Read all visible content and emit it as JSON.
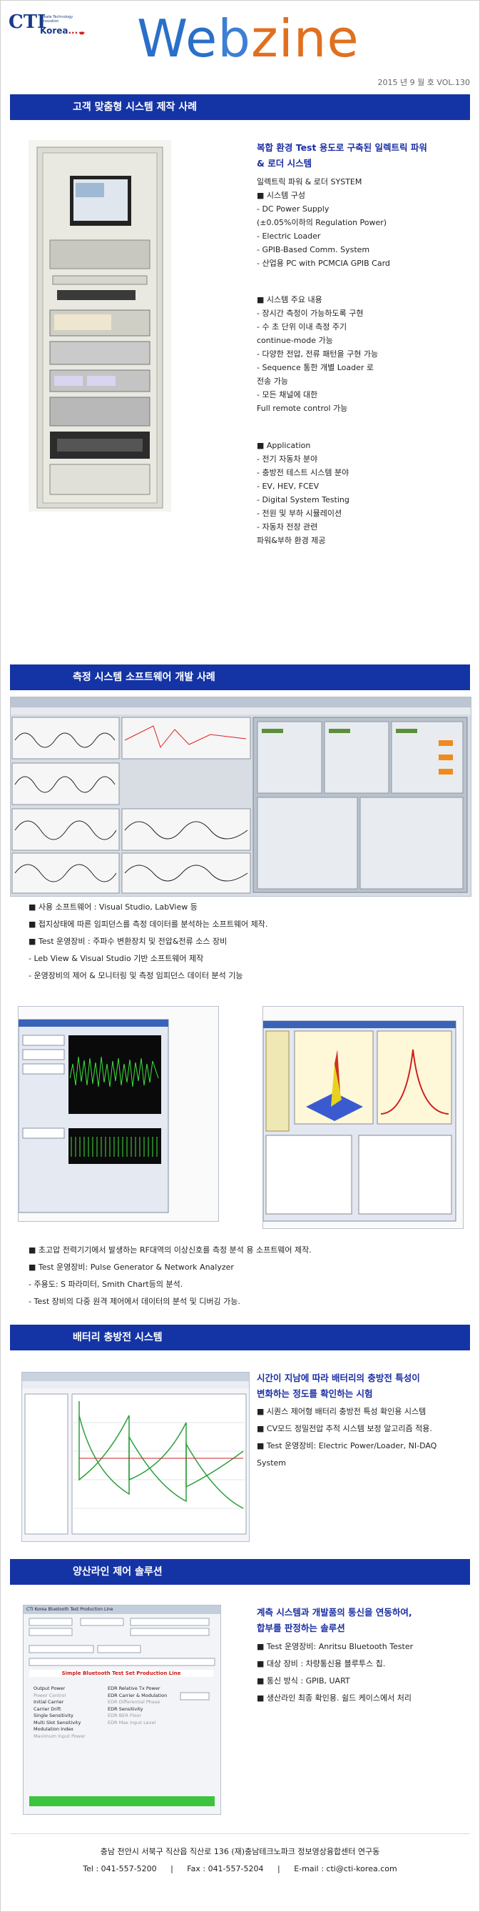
{
  "header": {
    "logo_main": "CTI",
    "logo_tag_1": "Create Technology Innovation",
    "logo_korea": "Korea",
    "logo_suffix": "...ᇂ",
    "title_letters": [
      "We",
      "b",
      "zine"
    ],
    "issue": "2015 년 9 월 호 VOL.130"
  },
  "section1": {
    "bar_title": "고객 맞춤형 시스템 제작 사례",
    "heading_1": "복합 환경 Test 용도로 구축된 일렉트릭 파워",
    "heading_2": "& 로더 시스템",
    "lines": [
      "일렉트릭 파워 & 로더 SYSTEM",
      "■ 시스템 구성",
      "- DC Power Supply",
      "(±0.05%이하의 Regulation Power)",
      "- Electric Loader",
      "- GPIB-Based Comm. System",
      "- 산업용 PC with PCMCIA GPIB Card",
      "",
      "■ 시스템 주요 내용",
      "- 장시간 측정이 가능하도록 구현",
      "- 수 초 단위 이내 측정 주기",
      "continue-mode 가능",
      "- 다양한 전압, 전류 패턴을 구현 가능",
      "- Sequence 통한 개별 Loader 로",
      "전송 가능",
      "- 모든 채널에 대한",
      "Full remote control 가능",
      "",
      "",
      "■ Application",
      "- 전기 자동차 분야",
      "- 충방전 테스트 시스템 분야",
      "- EV, HEV, FCEV",
      "- Digital System Testing",
      "- 전원 및 부하 시뮬레이션",
      "- 자동차 전장 관련",
      "파워&부하 환경 제공"
    ]
  },
  "section2": {
    "bar_title": "측정 시스템 소프트웨어 개발 사례",
    "bullets_a": [
      "■ 사용 소프트웨어 : Visual Studio, LabView 등",
      "■ 접지상태에 따른 임피던스를 측정 데이터를 분석하는 소프트웨어 제작.",
      "■ Test 운영장비 : 주파수 변환장치 및 전압&전류 소스 장비",
      "- Leb View & Visual Studio 기반 소프트웨어 제작",
      "- 운영장비의 제어 & 모니터링 및 측정 임피던스 데이터 분석 기능"
    ],
    "bullets_b": [
      "■ 초고압 전력기기에서 발생하는 RF대역의 이상신호를 측정 분석 용 소프트웨어 제작.",
      "■ Test 운영장비: Pulse Generator & Network Analyzer",
      "- 주용도: S 파라미터, Smith Chart등의 분석.",
      "- Test 장비의 다중 원격 제어에서 데이터의 분석 및 디버깅 가능."
    ]
  },
  "section3": {
    "bar_title": "배터리 충방전 시스템",
    "heading_1": "시간이 지남에 따라 배터리의 충방전 특성이",
    "heading_2": "변화하는 정도를 확인하는 시험",
    "bullets": [
      "■ 시퀀스 제어형 배터리 충방전 특성 확인용 시스템",
      "■ CV모드 정밀전압 추적 시스템 보정 알고리즘 적용.",
      "■ Test 운영장비: Electric Power/Loader, NI-DAQ",
      "System"
    ]
  },
  "section4": {
    "bar_title": "양산라인 제어 솔루션",
    "heading_1": "계측 시스템과 개발품의 통신을 연동하여,",
    "heading_2": "합부를 판정하는 솔루션",
    "bullets": [
      "■ Test 운영장비: Anritsu Bluetooth Tester",
      "■ 대상 장비 : 차량통신용 블루투스 칩.",
      "■ 통신 방식 : GPIB, UART",
      "■ 생산라인 최종 확인용. 쉴드 케이스에서 처리"
    ],
    "app_window_title": "CTI Korea Bluetooth Test Production Line",
    "app_banner": "Simple Bluetooth Test Set Production Line",
    "app_items_left": [
      "Output Power",
      "Power Control",
      "Initial Carrier",
      "Carrier Drift",
      "Single Sensitivity",
      "Multi Slot Sensitivity",
      "Modulation Index",
      "Maximum Input Power"
    ],
    "app_items_right": [
      "EDR Relative Tx Power",
      "EDR Carrier & Modulation",
      "EDR Differential Phase",
      "EDR Sensitivity",
      "EDR BER Floor",
      "EDR Max Input Level"
    ]
  },
  "footer": {
    "address": "충남 천안시 서북구 직산읍 직산로 136 (재)충남테크노파크 정보영상융합센터 연구동",
    "tel": "Tel : 041-557-5200",
    "fax": "Fax : 041-557-5204",
    "email": "E-mail : cti@cti-korea.com",
    "sep": "|"
  },
  "colors": {
    "bar": "#1434a6",
    "heading": "#1a2fa3",
    "title_blue": "#2a6fc9",
    "title_orange": "#e07020"
  }
}
